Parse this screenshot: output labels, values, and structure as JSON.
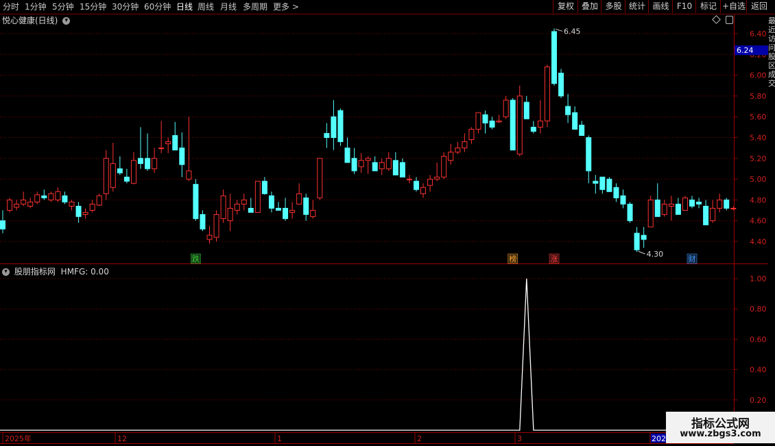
{
  "toolbar": {
    "periods": [
      "分时",
      "1分钟",
      "5分钟",
      "15分钟",
      "30分钟",
      "60分钟",
      "日线",
      "周线",
      "月线",
      "多周期",
      "更多 >"
    ],
    "active_period": "日线",
    "right_buttons": [
      "复权",
      "叠加",
      "多股",
      "统计",
      "画线",
      "F10",
      "标记",
      "+自选",
      "返回"
    ]
  },
  "main_panel": {
    "title": "悦心健康(日线)",
    "current_price": "6.24",
    "y_ticks": [
      "6.40",
      "6.20",
      "6.00",
      "5.80",
      "5.60",
      "5.40",
      "5.20",
      "5.00",
      "4.80",
      "4.60",
      "4.40"
    ],
    "high_label": "6.45",
    "low_label": "4.30",
    "tags": [
      {
        "text": "跌",
        "color": "#2fd02f",
        "bg": "#1a3a1a"
      },
      {
        "text": "榜",
        "color": "#ffa030",
        "bg": "#3a2a10"
      },
      {
        "text": "涨",
        "color": "#ff4040",
        "bg": "#3a1010"
      },
      {
        "text": "财",
        "color": "#40a0ff",
        "bg": "#10203a"
      }
    ]
  },
  "indicator_panel": {
    "title": "股朋指标网",
    "indicator_value": "HMFG: 0.00",
    "y_ticks": [
      "1.00",
      "0.80",
      "0.60",
      "0.40",
      "0.20"
    ]
  },
  "date_axis": {
    "labels": [
      "2025年",
      "12",
      "1",
      "2",
      "3",
      "202"
    ]
  },
  "right_edge_chars": [
    "最",
    "近",
    "访",
    "问",
    "股",
    "区",
    "成",
    "交"
  ],
  "watermark": {
    "line1": "指标公式网",
    "line2": "www.zbgs3.com"
  },
  "chart_data": {
    "type": "candlestick",
    "candles": [
      [
        4.6,
        4.7,
        4.48,
        4.52
      ],
      [
        4.7,
        4.82,
        4.68,
        4.8
      ],
      [
        4.73,
        4.8,
        4.7,
        4.76
      ],
      [
        4.76,
        4.88,
        4.74,
        4.8
      ],
      [
        4.74,
        4.82,
        4.72,
        4.78
      ],
      [
        4.78,
        4.88,
        4.76,
        4.85
      ],
      [
        4.84,
        4.9,
        4.8,
        4.82
      ],
      [
        4.8,
        4.88,
        4.78,
        4.86
      ],
      [
        4.8,
        4.92,
        4.78,
        4.88
      ],
      [
        4.84,
        4.88,
        4.76,
        4.78
      ],
      [
        4.74,
        4.8,
        4.7,
        4.78
      ],
      [
        4.74,
        4.78,
        4.58,
        4.64
      ],
      [
        4.66,
        4.72,
        4.62,
        4.68
      ],
      [
        4.7,
        4.8,
        4.68,
        4.76
      ],
      [
        4.75,
        4.86,
        4.74,
        4.84
      ],
      [
        4.86,
        5.28,
        4.8,
        5.2
      ],
      [
        4.92,
        5.35,
        4.88,
        5.15
      ],
      [
        5.1,
        5.22,
        5.04,
        5.06
      ],
      [
        5.02,
        5.1,
        4.96,
        4.98
      ],
      [
        4.96,
        5.26,
        4.95,
        5.18
      ],
      [
        5.2,
        5.5,
        5.1,
        5.15
      ],
      [
        5.2,
        5.44,
        5.08,
        5.1
      ],
      [
        5.1,
        5.3,
        5.06,
        5.2
      ],
      [
        5.3,
        5.56,
        5.25,
        5.3
      ],
      [
        5.34,
        5.4,
        5.25,
        5.36
      ],
      [
        5.42,
        5.55,
        5.3,
        5.28
      ],
      [
        5.3,
        5.45,
        5.02,
        5.14
      ],
      [
        5.0,
        5.6,
        4.98,
        5.08
      ],
      [
        4.95,
        5.0,
        4.6,
        4.62
      ],
      [
        4.66,
        4.7,
        4.5,
        4.52
      ],
      [
        4.42,
        4.55,
        4.38,
        4.46
      ],
      [
        4.44,
        4.7,
        4.4,
        4.66
      ],
      [
        4.62,
        4.9,
        4.58,
        4.84
      ],
      [
        4.6,
        4.86,
        4.5,
        4.72
      ],
      [
        4.7,
        4.8,
        4.66,
        4.76
      ],
      [
        4.76,
        4.86,
        4.7,
        4.8
      ],
      [
        4.72,
        4.82,
        4.7,
        4.68
      ],
      [
        4.68,
        4.96,
        4.68,
        4.98
      ],
      [
        4.98,
        5.02,
        4.85,
        4.86
      ],
      [
        4.84,
        4.88,
        4.68,
        4.72
      ],
      [
        4.72,
        4.78,
        4.7,
        4.7
      ],
      [
        4.72,
        4.82,
        4.6,
        4.62
      ],
      [
        4.68,
        4.78,
        4.62,
        4.7
      ],
      [
        4.76,
        4.96,
        4.76,
        4.86
      ],
      [
        4.82,
        4.86,
        4.6,
        4.66
      ],
      [
        4.64,
        4.8,
        4.62,
        4.7
      ],
      [
        4.82,
        5.2,
        4.8,
        5.2
      ],
      [
        5.44,
        5.54,
        5.3,
        5.4
      ],
      [
        5.6,
        5.76,
        5.28,
        5.4
      ],
      [
        5.66,
        5.68,
        5.32,
        5.36
      ],
      [
        5.3,
        5.4,
        5.18,
        5.16
      ],
      [
        5.2,
        5.3,
        5.05,
        5.08
      ],
      [
        5.12,
        5.25,
        5.06,
        5.18
      ],
      [
        5.18,
        5.22,
        5.05,
        5.2
      ],
      [
        5.16,
        5.22,
        5.08,
        5.08
      ],
      [
        5.1,
        5.2,
        5.04,
        5.16
      ],
      [
        5.1,
        5.26,
        5.08,
        5.2
      ],
      [
        5.18,
        5.26,
        5.04,
        5.04
      ],
      [
        5.16,
        5.2,
        5.02,
        5.02
      ],
      [
        5.0,
        5.04,
        4.96,
        5.0
      ],
      [
        4.98,
        5.02,
        4.88,
        4.9
      ],
      [
        4.86,
        4.96,
        4.82,
        4.92
      ],
      [
        4.94,
        5.04,
        4.88,
        5.0
      ],
      [
        5.0,
        5.16,
        4.98,
        5.02
      ],
      [
        5.02,
        5.26,
        5.0,
        5.22
      ],
      [
        5.18,
        5.34,
        5.14,
        5.26
      ],
      [
        5.26,
        5.36,
        5.24,
        5.3
      ],
      [
        5.3,
        5.44,
        5.26,
        5.36
      ],
      [
        5.38,
        5.5,
        5.34,
        5.48
      ],
      [
        5.48,
        5.64,
        5.44,
        5.64
      ],
      [
        5.62,
        5.66,
        5.44,
        5.54
      ],
      [
        5.56,
        5.6,
        5.48,
        5.5
      ],
      [
        5.55,
        5.62,
        5.54,
        5.56
      ],
      [
        5.6,
        5.8,
        5.58,
        5.76
      ],
      [
        5.76,
        5.78,
        5.3,
        5.28
      ],
      [
        5.24,
        5.9,
        5.22,
        5.8
      ],
      [
        5.74,
        5.8,
        5.6,
        5.58
      ],
      [
        5.5,
        5.56,
        5.44,
        5.46
      ],
      [
        5.5,
        5.76,
        5.44,
        5.56
      ],
      [
        5.56,
        6.1,
        5.5,
        6.08
      ],
      [
        6.42,
        6.45,
        5.9,
        5.92
      ],
      [
        6.02,
        6.06,
        5.78,
        5.8
      ],
      [
        5.7,
        5.82,
        5.54,
        5.62
      ],
      [
        5.64,
        5.7,
        5.48,
        5.48
      ],
      [
        5.52,
        5.56,
        5.42,
        5.42
      ],
      [
        5.4,
        5.42,
        4.96,
        5.08
      ],
      [
        4.98,
        5.04,
        4.86,
        4.96
      ],
      [
        5.02,
        5.02,
        4.86,
        4.9
      ],
      [
        5.0,
        5.02,
        4.88,
        4.88
      ],
      [
        4.92,
        4.96,
        4.78,
        4.82
      ],
      [
        4.84,
        4.9,
        4.72,
        4.76
      ],
      [
        4.76,
        4.78,
        4.58,
        4.6
      ],
      [
        4.48,
        4.54,
        4.3,
        4.32
      ],
      [
        4.46,
        4.54,
        4.34,
        4.42
      ],
      [
        4.54,
        4.84,
        4.54,
        4.8
      ],
      [
        4.8,
        4.96,
        4.64,
        4.64
      ],
      [
        4.66,
        4.8,
        4.64,
        4.76
      ],
      [
        4.74,
        4.84,
        4.6,
        4.76
      ],
      [
        4.76,
        4.82,
        4.68,
        4.66
      ],
      [
        4.7,
        4.84,
        4.7,
        4.82
      ],
      [
        4.8,
        4.84,
        4.72,
        4.74
      ],
      [
        4.78,
        4.82,
        4.72,
        4.76
      ],
      [
        4.74,
        4.8,
        4.56,
        4.56
      ],
      [
        4.6,
        4.8,
        4.58,
        4.72
      ],
      [
        4.72,
        4.86,
        4.68,
        4.8
      ],
      [
        4.8,
        4.82,
        4.7,
        4.72
      ],
      [
        4.72,
        4.74,
        4.7,
        4.72
      ]
    ],
    "main_ylim": [
      4.3,
      6.5
    ],
    "indicator": {
      "name": "HMFG",
      "values": [
        0,
        0,
        0,
        0,
        0,
        0,
        0,
        0,
        0,
        0,
        0,
        0,
        0,
        0,
        0,
        0,
        0,
        0,
        0,
        0,
        0,
        0,
        0,
        0,
        0,
        0,
        0,
        0,
        0,
        0,
        0,
        0,
        0,
        0,
        0,
        0,
        0,
        0,
        0,
        0,
        0,
        0,
        0,
        0,
        0,
        0,
        0,
        0,
        0,
        0,
        0,
        0,
        0,
        0,
        0,
        0,
        0,
        0,
        0,
        0,
        0,
        0,
        0,
        0,
        0,
        0,
        0,
        0,
        0,
        0,
        0,
        0,
        0,
        0,
        0,
        0,
        0,
        0,
        0,
        0,
        0,
        0,
        0,
        0,
        0,
        0,
        0,
        0,
        0,
        0,
        0,
        0,
        0,
        0,
        0,
        0,
        0,
        0,
        0,
        0,
        0,
        0,
        0,
        0,
        0,
        0,
        0,
        0,
        0,
        0,
        0
      ],
      "spike_index": 76,
      "spike_value": 1.0,
      "ylim": [
        0,
        1.0
      ]
    },
    "tag_candle_indices": [
      28,
      74,
      80,
      100
    ],
    "colors": {
      "up": "#ff3232",
      "down": "#54ffff",
      "grid": "#8b0000",
      "line": "#ffffff"
    }
  }
}
